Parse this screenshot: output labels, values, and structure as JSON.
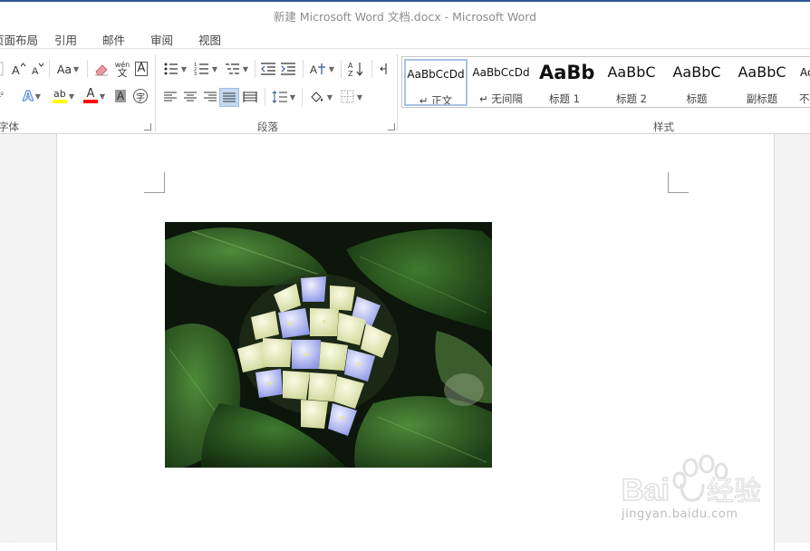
{
  "window": {
    "title": "新建 Microsoft Word 文档.docx - Microsoft Word"
  },
  "tabs": [
    "页面布局",
    "引用",
    "邮件",
    "审阅",
    "视图"
  ],
  "font_group": {
    "label": "字体",
    "change_case": "Aa",
    "phonetic_top": "wén",
    "phonetic_bottom": "文",
    "char_border": "A",
    "enclose": "字",
    "text_effect": "A",
    "highlight": "ab",
    "font_color": "A",
    "shading": "A"
  },
  "paragraph_group": {
    "label": "段落",
    "sort_top": "A",
    "sort_bottom": "Z"
  },
  "styles_group": {
    "label": "样式",
    "items": [
      {
        "sample": "AaBbCcDd",
        "name": "↵ 正文"
      },
      {
        "sample": "AaBbCcDd",
        "name": "↵ 无间隔"
      },
      {
        "sample": "AaBb",
        "name": "标题 1"
      },
      {
        "sample": "AaBbC",
        "name": "标题 2"
      },
      {
        "sample": "AaBbC",
        "name": "标题"
      },
      {
        "sample": "AaBbC",
        "name": "副标题"
      },
      {
        "sample": "Ac",
        "name": "不"
      }
    ]
  },
  "colors": {
    "accent": "#2b579a",
    "highlight_yellow": "#ffff00",
    "font_red": "#ff0000",
    "gallery_selected": "#a7c3e4"
  },
  "watermark": {
    "logo": "Bai 经验",
    "url": "jingyan.baidu.com"
  },
  "document": {
    "image_subject": "hydrangea"
  }
}
